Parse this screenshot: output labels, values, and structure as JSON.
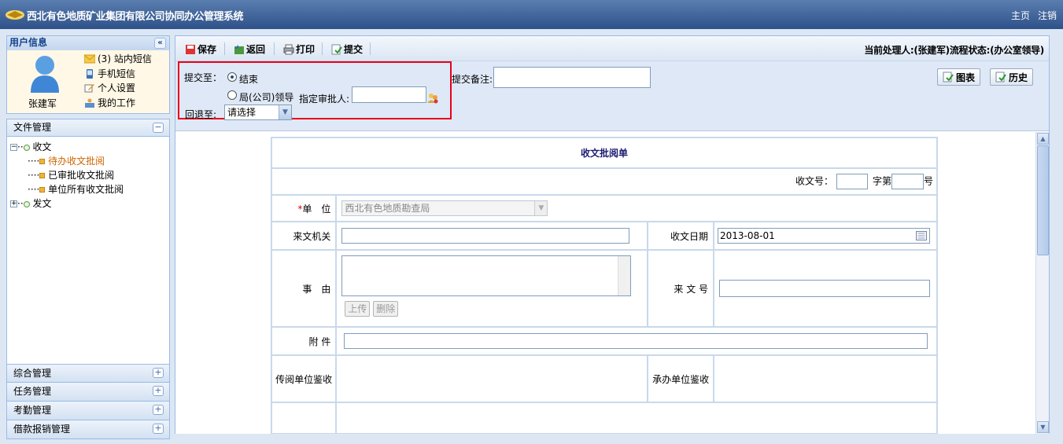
{
  "header": {
    "title": "西北有色地质矿业集团有限公司协同办公管理系统",
    "link_home": "主页",
    "link_logout": "注销"
  },
  "user": {
    "panel_title": "用户信息",
    "name": "张建军",
    "links": [
      {
        "label": "(3) 站内短信",
        "icon": "envelope-icon"
      },
      {
        "label": "手机短信",
        "icon": "phone-icon"
      },
      {
        "label": "个人设置",
        "icon": "edit-icon"
      },
      {
        "label": "我的工作",
        "icon": "work-icon"
      }
    ]
  },
  "filemgmt": {
    "title": "文件管理",
    "tree": {
      "received": "收文",
      "pending": "待办收文批阅",
      "approved": "已审批收文批阅",
      "all_unit": "单位所有收文批阅",
      "sent": "发文"
    }
  },
  "accordion": [
    "综合管理",
    "任务管理",
    "考勤管理",
    "借款报销管理"
  ],
  "toolbar": {
    "save": "保存",
    "back": "返回",
    "print": "打印",
    "submit": "提交",
    "handler": "当前处理人:(张建军)流程状态:(办公室领导)"
  },
  "submit": {
    "to_label": "提交至：",
    "opt_end": "结束",
    "opt_leader": "局(公司)领导",
    "approver_label": "指定审批人:",
    "return_label": "回退至:",
    "return_select": "请选择",
    "remark_label": "提交备注:",
    "chart_btn": "图表",
    "history_btn": "历史"
  },
  "form": {
    "title": "收文批阅单",
    "doc_no_label": "收文号：",
    "char_label": "字第",
    "no_suffix": "号",
    "unit_label": "单　位",
    "unit_value": "西北有色地质勘查局",
    "from_label": "来文机关",
    "date_label": "收文日期",
    "date_value": "2013-08-01",
    "reason_label": "事　由",
    "upload": "上传",
    "delete": "删除",
    "incoming_no_label": "来 文 号",
    "attach_label": "附 件",
    "circ_label": "传阅单位鉴收",
    "handle_label": "承办单位鉴收"
  }
}
